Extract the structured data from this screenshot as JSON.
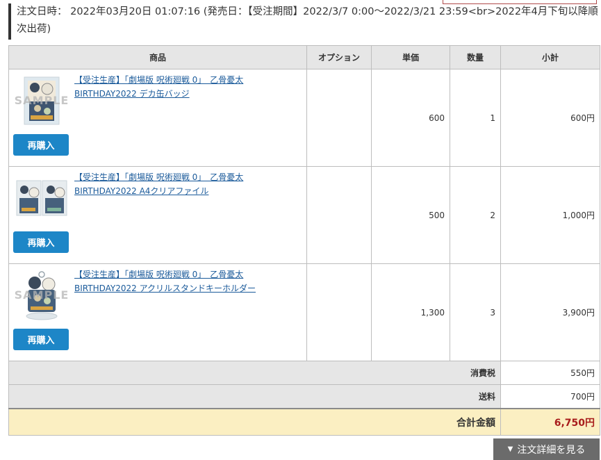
{
  "order_info": {
    "text": "注文日時： 2022年03月20日 01:07:16 (発売日：【受注期間】2022/3/7 0:00〜2022/3/21 23:59<br>2022年4月下旬以降順次出荷)"
  },
  "table": {
    "headers": {
      "product": "商品",
      "option": "オプション",
      "price": "単価",
      "qty": "数量",
      "subtotal": "小計"
    },
    "rows": [
      {
        "name": "【受注生産】「劇場版 呪術廻戦 0」　乙骨憂太BIRTHDAY2022 デカ缶バッジ",
        "sample": "SAMPLE",
        "rebuy": "再購入",
        "option": "",
        "price": "600",
        "qty": "1",
        "subtotal": "600円"
      },
      {
        "name": "【受注生産】「劇場版 呪術廻戦 0」　乙骨憂太BIRTHDAY2022 A4クリアファイル",
        "sample": "",
        "rebuy": "再購入",
        "option": "",
        "price": "500",
        "qty": "2",
        "subtotal": "1,000円"
      },
      {
        "name": "【受注生産】「劇場版 呪術廻戦 0」　乙骨憂太BIRTHDAY2022 アクリルスタンドキーホルダー",
        "sample": "SAMPLE",
        "rebuy": "再購入",
        "option": "",
        "price": "1,300",
        "qty": "3",
        "subtotal": "3,900円"
      }
    ],
    "tax": {
      "label": "消費税",
      "value": "550円"
    },
    "shipping": {
      "label": "送料",
      "value": "700円"
    },
    "total": {
      "label": "合計金額",
      "value": "6,750円"
    }
  },
  "detail_button": {
    "arrow": "▼",
    "label": "注文詳細を見る"
  },
  "colors": {
    "rebuy_button": "#1d86c7",
    "total_value": "#a81c1c",
    "total_bg": "#fbefc2",
    "header_bg": "#e6e6e6",
    "link": "#1a5a9a"
  }
}
